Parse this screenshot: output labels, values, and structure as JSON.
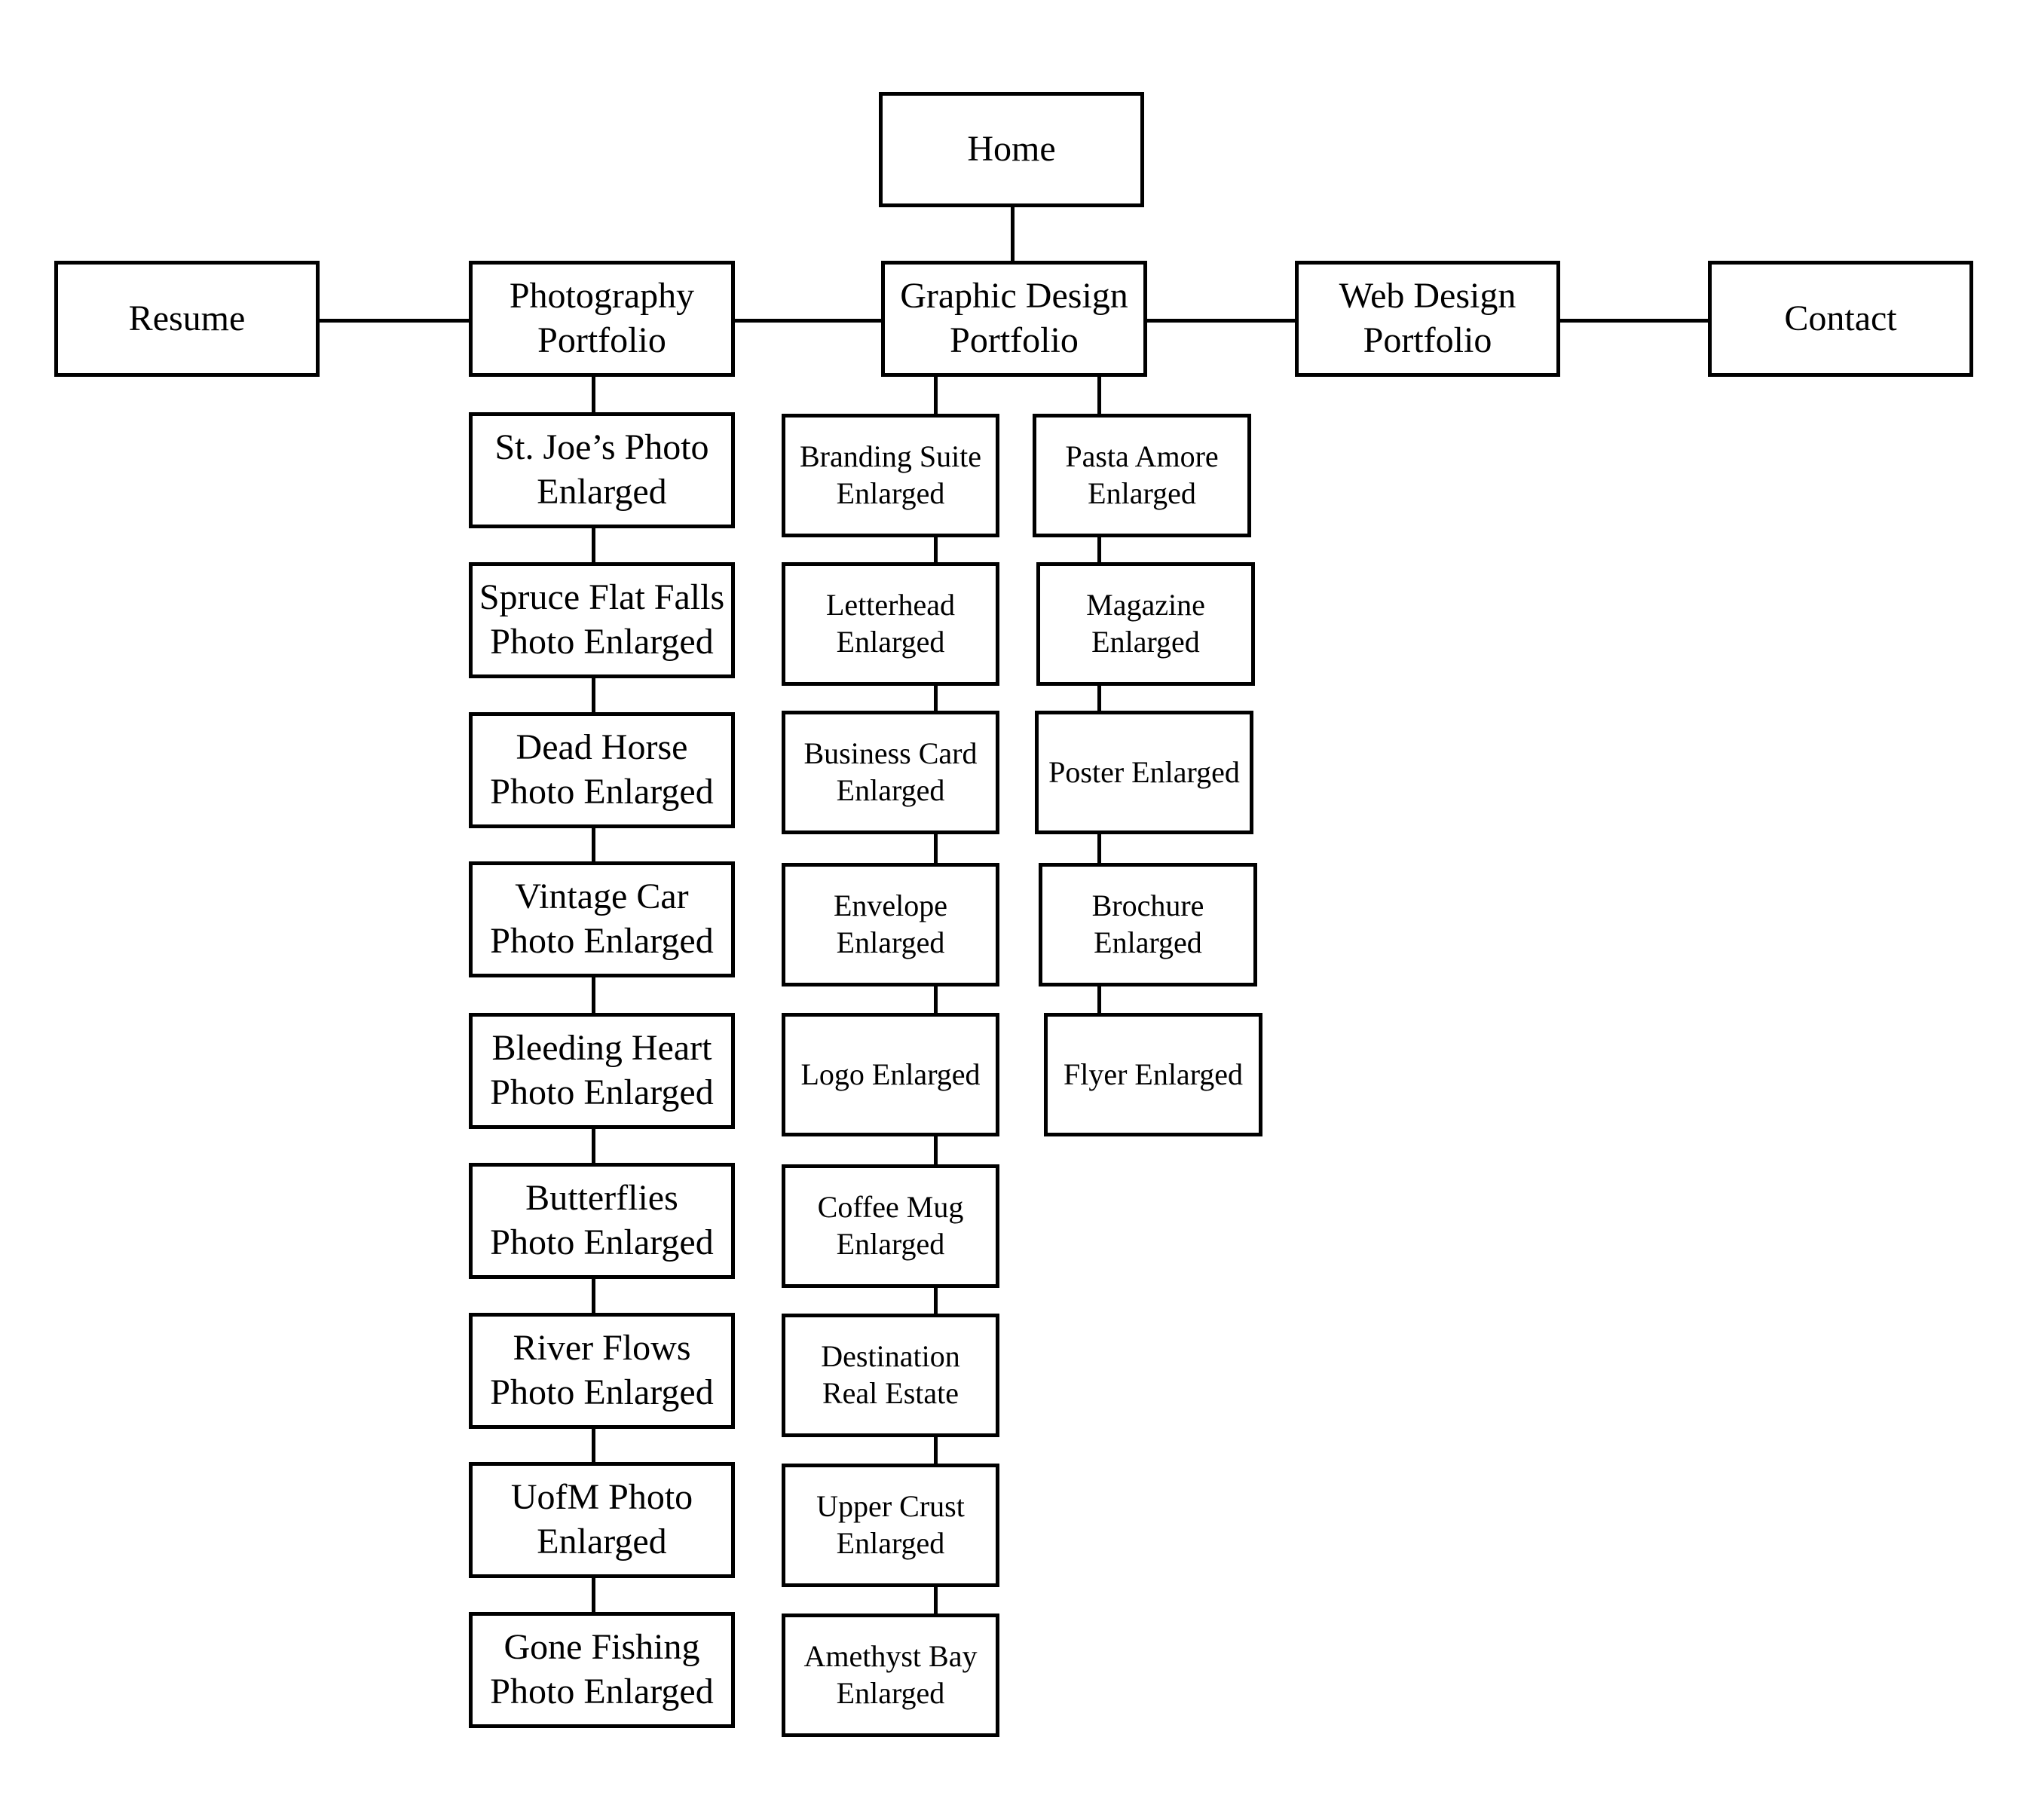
{
  "sitemap": {
    "home": {
      "label": "Home"
    },
    "sections": [
      {
        "id": "resume",
        "label": "Resume"
      },
      {
        "id": "photography",
        "label": "Photography\nPortfolio"
      },
      {
        "id": "graphic-design",
        "label": "Graphic Design\nPortfolio"
      },
      {
        "id": "web-design",
        "label": "Web Design\nPortfolio"
      },
      {
        "id": "contact",
        "label": "Contact"
      }
    ],
    "photography_pages": [
      "St. Joe’s Photo\nEnlarged",
      "Spruce Flat Falls\nPhoto Enlarged",
      "Dead Horse\nPhoto Enlarged",
      "Vintage Car\nPhoto Enlarged",
      "Bleeding Heart\nPhoto Enlarged",
      "Butterflies\nPhoto Enlarged",
      "River Flows\nPhoto Enlarged",
      "UofM Photo\nEnlarged",
      "Gone Fishing\nPhoto Enlarged"
    ],
    "graphic_design_pages_col1": [
      "Branding Suite\nEnlarged",
      "Letterhead\nEnlarged",
      "Business Card\nEnlarged",
      "Envelope\nEnlarged",
      "Logo Enlarged",
      "Coffee Mug\nEnlarged",
      "Destination\nReal Estate",
      "Upper Crust\nEnlarged",
      "Amethyst Bay\nEnlarged"
    ],
    "graphic_design_pages_col2": [
      "Pasta Amore\nEnlarged",
      "Magazine\nEnlarged",
      "Poster Enlarged",
      "Brochure\nEnlarged",
      "Flyer Enlarged"
    ]
  }
}
